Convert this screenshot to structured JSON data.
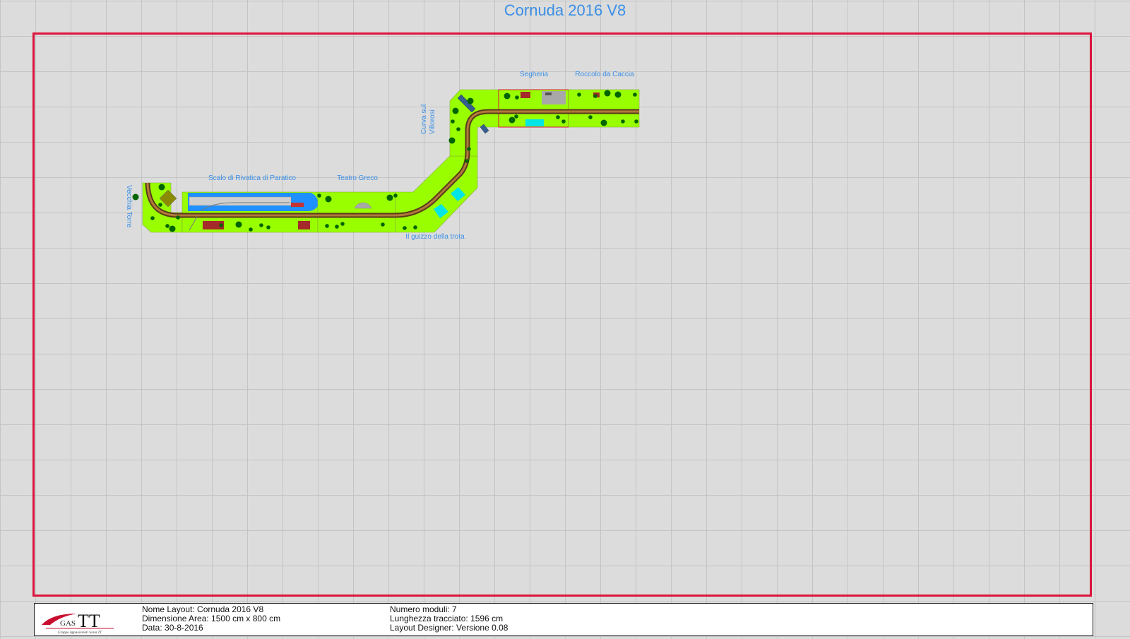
{
  "title": "Cornuda 2016 V8",
  "modules": [
    {
      "name": "Vecchia Torre"
    },
    {
      "name": "Scalo di Rivatica di Paratico"
    },
    {
      "name": "Teatro Greco"
    },
    {
      "name": "Il guizzo della trota"
    },
    {
      "name": "Curva sul Villorosi"
    },
    {
      "name": "Segheria"
    },
    {
      "name": "Roccolo da Caccia"
    }
  ],
  "info": {
    "layout_name": "Nome Layout: Cornuda 2016 V8",
    "area": "Dimensione Area: 1500 cm x 800 cm",
    "date": "Data: 30-8-2016",
    "modules_count": "Numero moduli: 7",
    "track_length": "Lunghezza tracciato: 1596 cm",
    "designer": "Layout Designer: Versione 0.08"
  },
  "logo": {
    "gas": "GAS",
    "tt": "TT",
    "subtitle": "Gruppo Appassionati Scala TT"
  },
  "colors": {
    "module_fill": "#99ff00",
    "area_border": "#dc143c",
    "label": "#3b8fe6",
    "track": "#8b5a2b",
    "tree": "#006400",
    "water": "#1e90ff",
    "building": "#a52a2a"
  }
}
